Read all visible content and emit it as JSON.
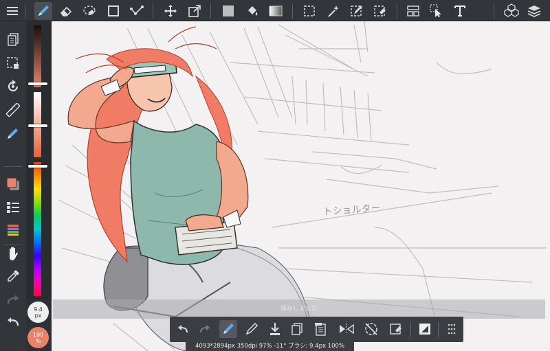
{
  "top_toolbar": {
    "menu_icon": "hamburger-menu",
    "tools": [
      "pen",
      "eraser",
      "lasso-eraser",
      "rectangle",
      "snap",
      "move",
      "transform",
      "fill-color",
      "bucket",
      "gradient",
      "select",
      "magic-wand",
      "select-pen",
      "select-eraser",
      "panel-layout",
      "operation",
      "text"
    ],
    "active_tool": "pen",
    "right_tools": [
      "material",
      "layers"
    ]
  },
  "left_toolbar": {
    "tools": [
      "pages",
      "selection",
      "rotate",
      "ruler",
      "pen-settings",
      "color",
      "brush-list",
      "color-palette",
      "hand",
      "eyedropper",
      "redo",
      "undo"
    ]
  },
  "brush_size": {
    "value": "9.4",
    "unit": "px"
  },
  "brush_opacity": {
    "value": "100",
    "unit": "%"
  },
  "color_strip": {
    "current_color": "#e8836a",
    "brightness": 0.78,
    "saturation": 0.62,
    "hue": 0.04
  },
  "hint_text": "保存しました",
  "quickbar": {
    "buttons": [
      "undo",
      "redo",
      "pen",
      "eraser-pen",
      "import",
      "copy",
      "paste",
      "flip",
      "no-rotate",
      "clear",
      "layer-toggle",
      "more"
    ],
    "active": "pen"
  },
  "status": {
    "text": "4093*2894px 350dpi 97% -11° ブラシ: 9.4px 100%"
  },
  "canvas": {
    "sketch_note": "トショルター"
  }
}
